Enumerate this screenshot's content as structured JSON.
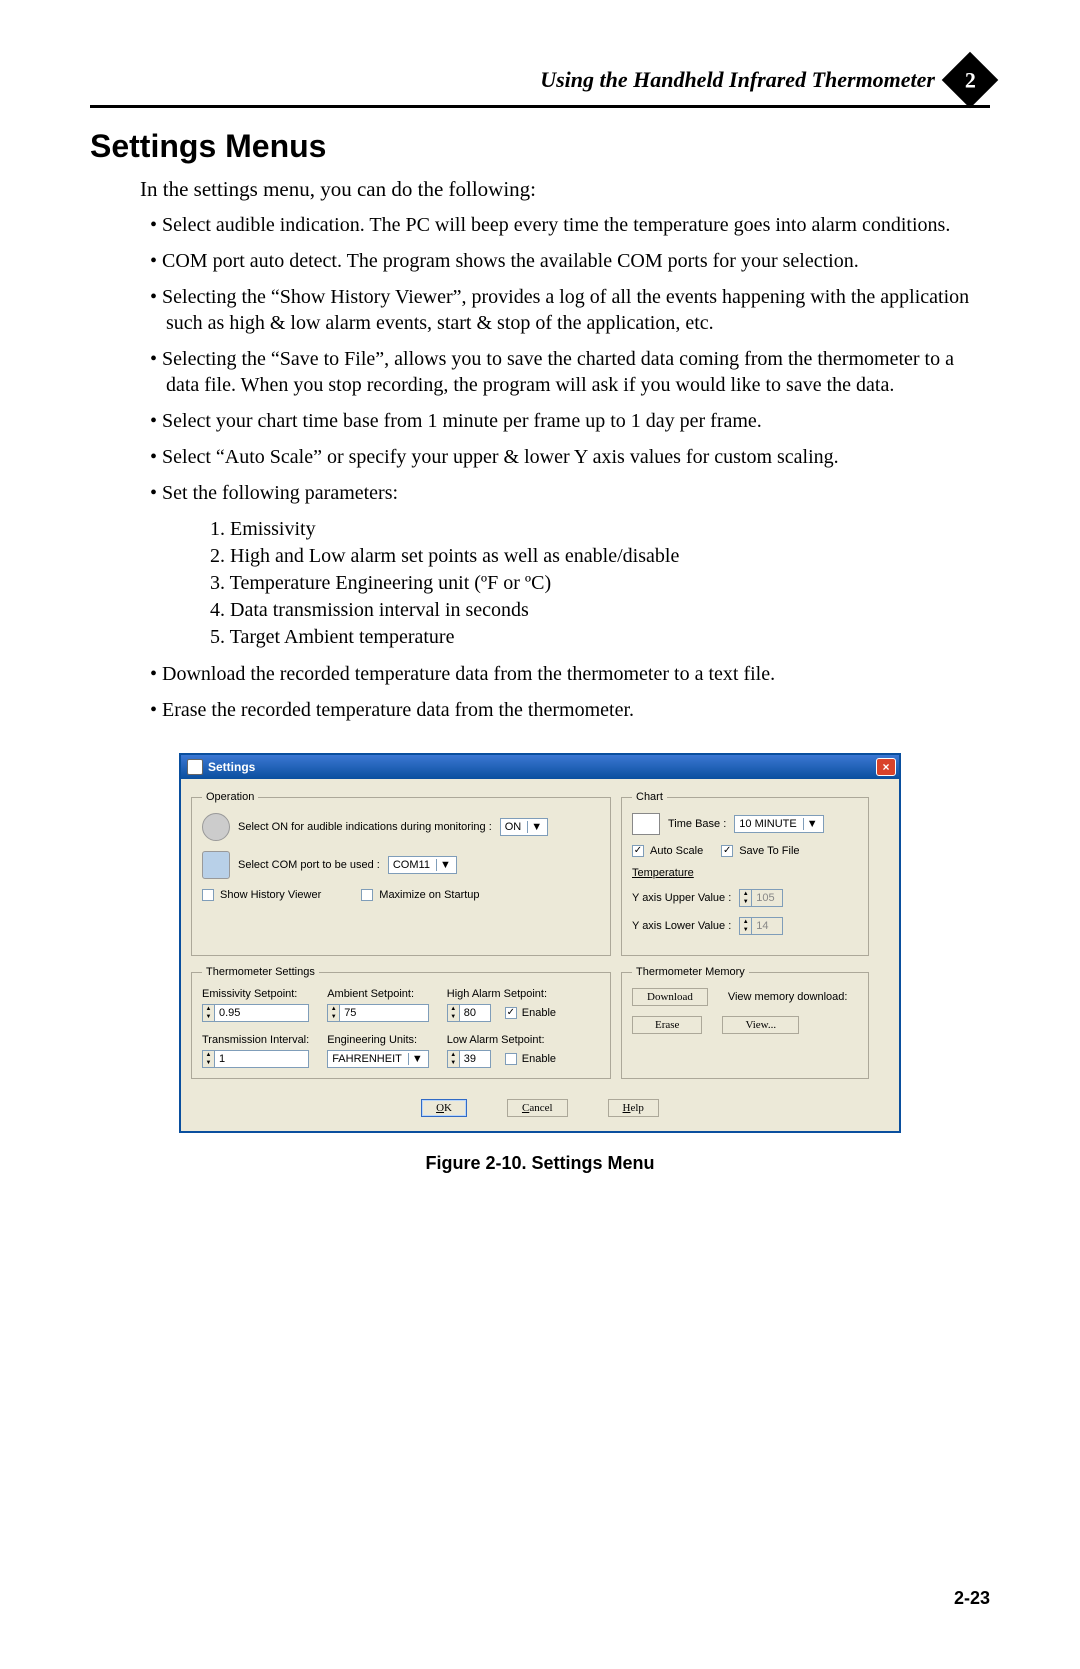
{
  "header": {
    "title": "Using the Handheld Infrared Thermometer",
    "chapter": "2"
  },
  "h1": "Settings Menus",
  "intro": "In the settings menu, you can do the following:",
  "bullets": [
    "Select audible indication. The PC will beep every time the temperature goes into alarm conditions.",
    "COM port auto detect. The program shows the available COM ports for your selection.",
    "Selecting the “Show History Viewer”, provides a log of all the events happening with the application such as high & low alarm events, start & stop of the application, etc.",
    "Selecting the “Save to File”, allows you to save the charted data coming from the thermometer to a data file. When you stop recording, the program will ask if you would like to save the data.",
    "Select your chart time base from 1 minute per frame up to 1 day per frame.",
    "Select “Auto Scale” or specify your upper & lower Y axis values for custom scaling.",
    "Set the following parameters:"
  ],
  "sublist": [
    "1. Emissivity",
    "2. High and Low alarm set points as well as enable/disable",
    "3. Temperature Engineering unit (ºF or ºC)",
    "4. Data transmission interval in seconds",
    "5. Target Ambient temperature"
  ],
  "bullets2": [
    "Download the recorded temperature data from the thermometer to a text file.",
    "Erase the recorded temperature data from the thermometer."
  ],
  "dialog": {
    "title": "Settings",
    "operation": {
      "legend": "Operation",
      "audible_lbl": "Select ON for audible indications during monitoring :",
      "audible_val": "ON",
      "com_lbl": "Select COM port to be used :",
      "com_val": "COM11",
      "history_lbl": "Show  History Viewer",
      "maximize_lbl": "Maximize on Startup"
    },
    "chart": {
      "legend": "Chart",
      "timebase_lbl": "Time Base :",
      "timebase_val": "10 MINUTE",
      "autoscale_lbl": "Auto Scale",
      "save_lbl": "Save To File",
      "temp_lbl": "Temperature",
      "yupper_lbl": "Y axis Upper Value :",
      "yupper_val": "105",
      "ylower_lbl": "Y axis Lower Value :",
      "ylower_val": "14"
    },
    "thermo": {
      "legend": "Thermometer Settings",
      "emissivity_lbl": "Emissivity Setpoint:",
      "emissivity_val": "0.95",
      "ambient_lbl": "Ambient Setpoint:",
      "ambient_val": "75",
      "high_lbl": "High Alarm Setpoint:",
      "high_val": "80",
      "high_enable": "Enable",
      "trans_lbl": "Transmission Interval:",
      "trans_val": "1",
      "eng_lbl": "Engineering Units:",
      "eng_val": "FAHRENHEIT",
      "low_lbl": "Low Alarm Setpoint:",
      "low_val": "39",
      "low_enable": "Enable"
    },
    "memory": {
      "legend": "Thermometer Memory",
      "download_btn": "Download",
      "download_lbl": "View memory download:",
      "erase_btn": "Erase",
      "view_btn": "View..."
    },
    "buttons": {
      "ok": "OK",
      "cancel": "Cancel",
      "help": "Help"
    }
  },
  "caption": "Figure 2-10.  Settings Menu",
  "page": "2-23"
}
